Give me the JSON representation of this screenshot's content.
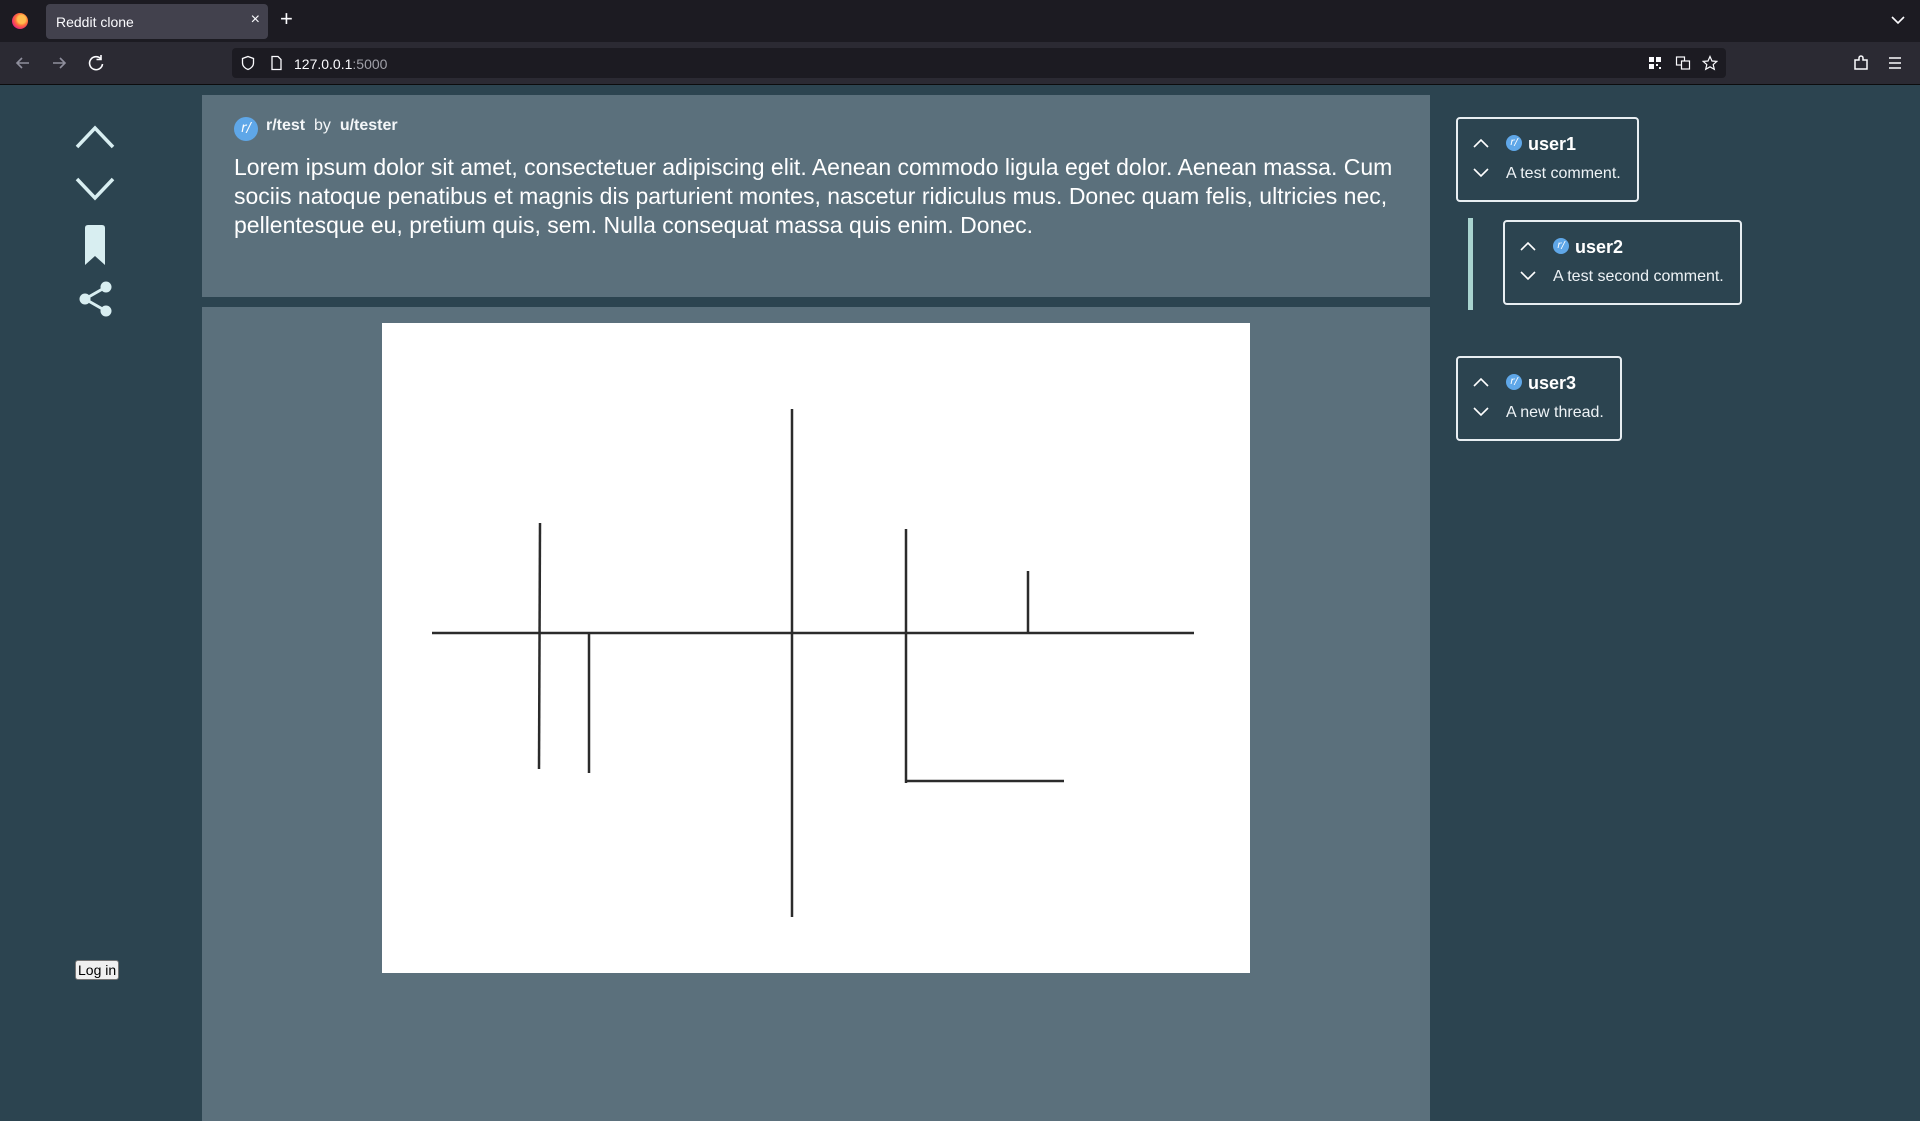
{
  "browser": {
    "tab_title": "Reddit clone",
    "tab_close": "×",
    "new_tab": "+",
    "url_host": "127.0.0.1",
    "url_port": ":5000"
  },
  "post": {
    "subreddit": "r/test",
    "by": "by",
    "author": "u/tester",
    "body": "Lorem ipsum dolor sit amet, consectetuer adipiscing elit. Aenean commodo ligula eget dolor. Aenean massa. Cum sociis natoque penatibus et magnis dis parturient montes, nascetur ridiculus mus. Donec quam felis, ultricies nec, pellentesque eu, pretium quis, sem. Nulla consequat massa quis enim. Donec."
  },
  "sidebar": {
    "icons": [
      "upvote-icon",
      "downvote-icon",
      "bookmark-icon",
      "share-icon"
    ],
    "login_label": "Log in"
  },
  "comments": [
    {
      "user": "user1",
      "text": "A test comment."
    },
    {
      "user": "user2",
      "text": "A test second comment."
    },
    {
      "user": "user3",
      "text": "A new thread."
    }
  ],
  "avatar_glyph": "r/",
  "colors": {
    "page_bg": "#2c4450",
    "panel_bg": "#5b707c",
    "accent_blue": "#5fa7e8",
    "thread_line": "#a9d4cf"
  }
}
